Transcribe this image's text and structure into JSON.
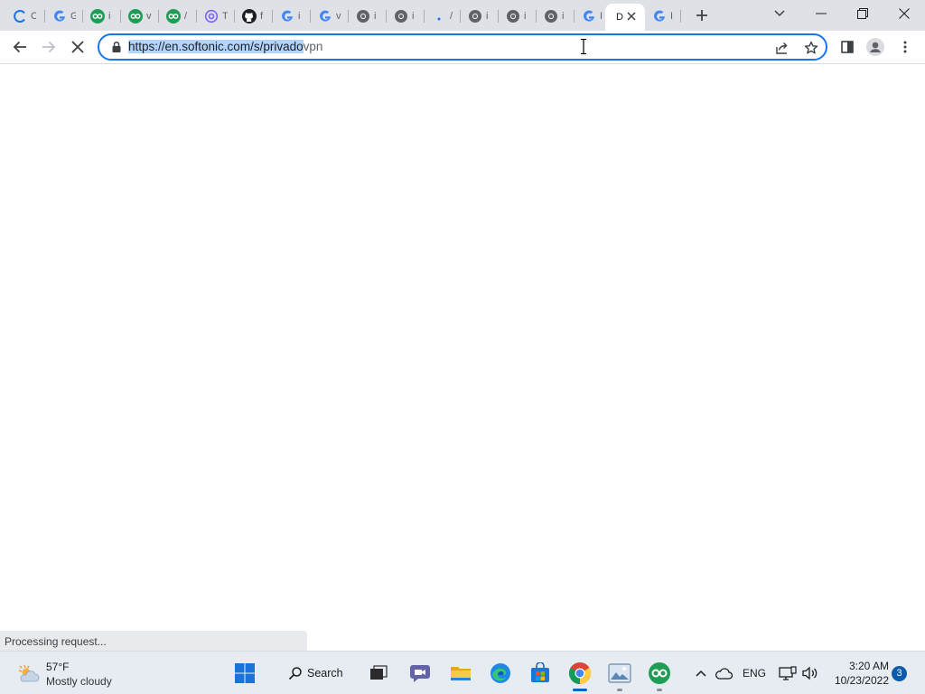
{
  "browser": {
    "tabs": [
      {
        "title": "C",
        "favicon": "loading-spinner-icon"
      },
      {
        "title": "G",
        "favicon": "google-icon"
      },
      {
        "title": "i",
        "favicon": "goo-icon"
      },
      {
        "title": "v",
        "favicon": "goo-icon"
      },
      {
        "title": "/",
        "favicon": "goo-icon"
      },
      {
        "title": "T",
        "favicon": "at-sign-icon"
      },
      {
        "title": "f",
        "favicon": "github-icon"
      },
      {
        "title": "i",
        "favicon": "google-icon"
      },
      {
        "title": "v",
        "favicon": "google-icon"
      },
      {
        "title": "i",
        "favicon": "chrome-gray-icon"
      },
      {
        "title": "i",
        "favicon": "chrome-gray-icon"
      },
      {
        "title": "/",
        "favicon": "dot-icon"
      },
      {
        "title": "i",
        "favicon": "chrome-gray-icon"
      },
      {
        "title": "i",
        "favicon": "chrome-gray-icon"
      },
      {
        "title": "i",
        "favicon": "chrome-gray-icon"
      },
      {
        "title": "I",
        "favicon": "google-icon"
      },
      {
        "title": "D",
        "favicon": "",
        "active": true
      },
      {
        "title": "I",
        "favicon": "google-icon"
      }
    ],
    "address_bar": {
      "url_selected": "https://en.softonic.com/s/privado",
      "url_rest": "vpn"
    },
    "status_text": "Processing request..."
  },
  "taskbar": {
    "weather": {
      "temp": "57°F",
      "condition": "Mostly cloudy"
    },
    "search_label": "Search",
    "tray": {
      "language": "ENG",
      "time": "3:20 AM",
      "date": "10/23/2022",
      "notification_count": "3"
    }
  },
  "colors": {
    "accent": "#1a73e8",
    "selection": "#b3d4fc",
    "tab_strip": "#dee1e6",
    "taskbar": "#e7ecf3"
  }
}
